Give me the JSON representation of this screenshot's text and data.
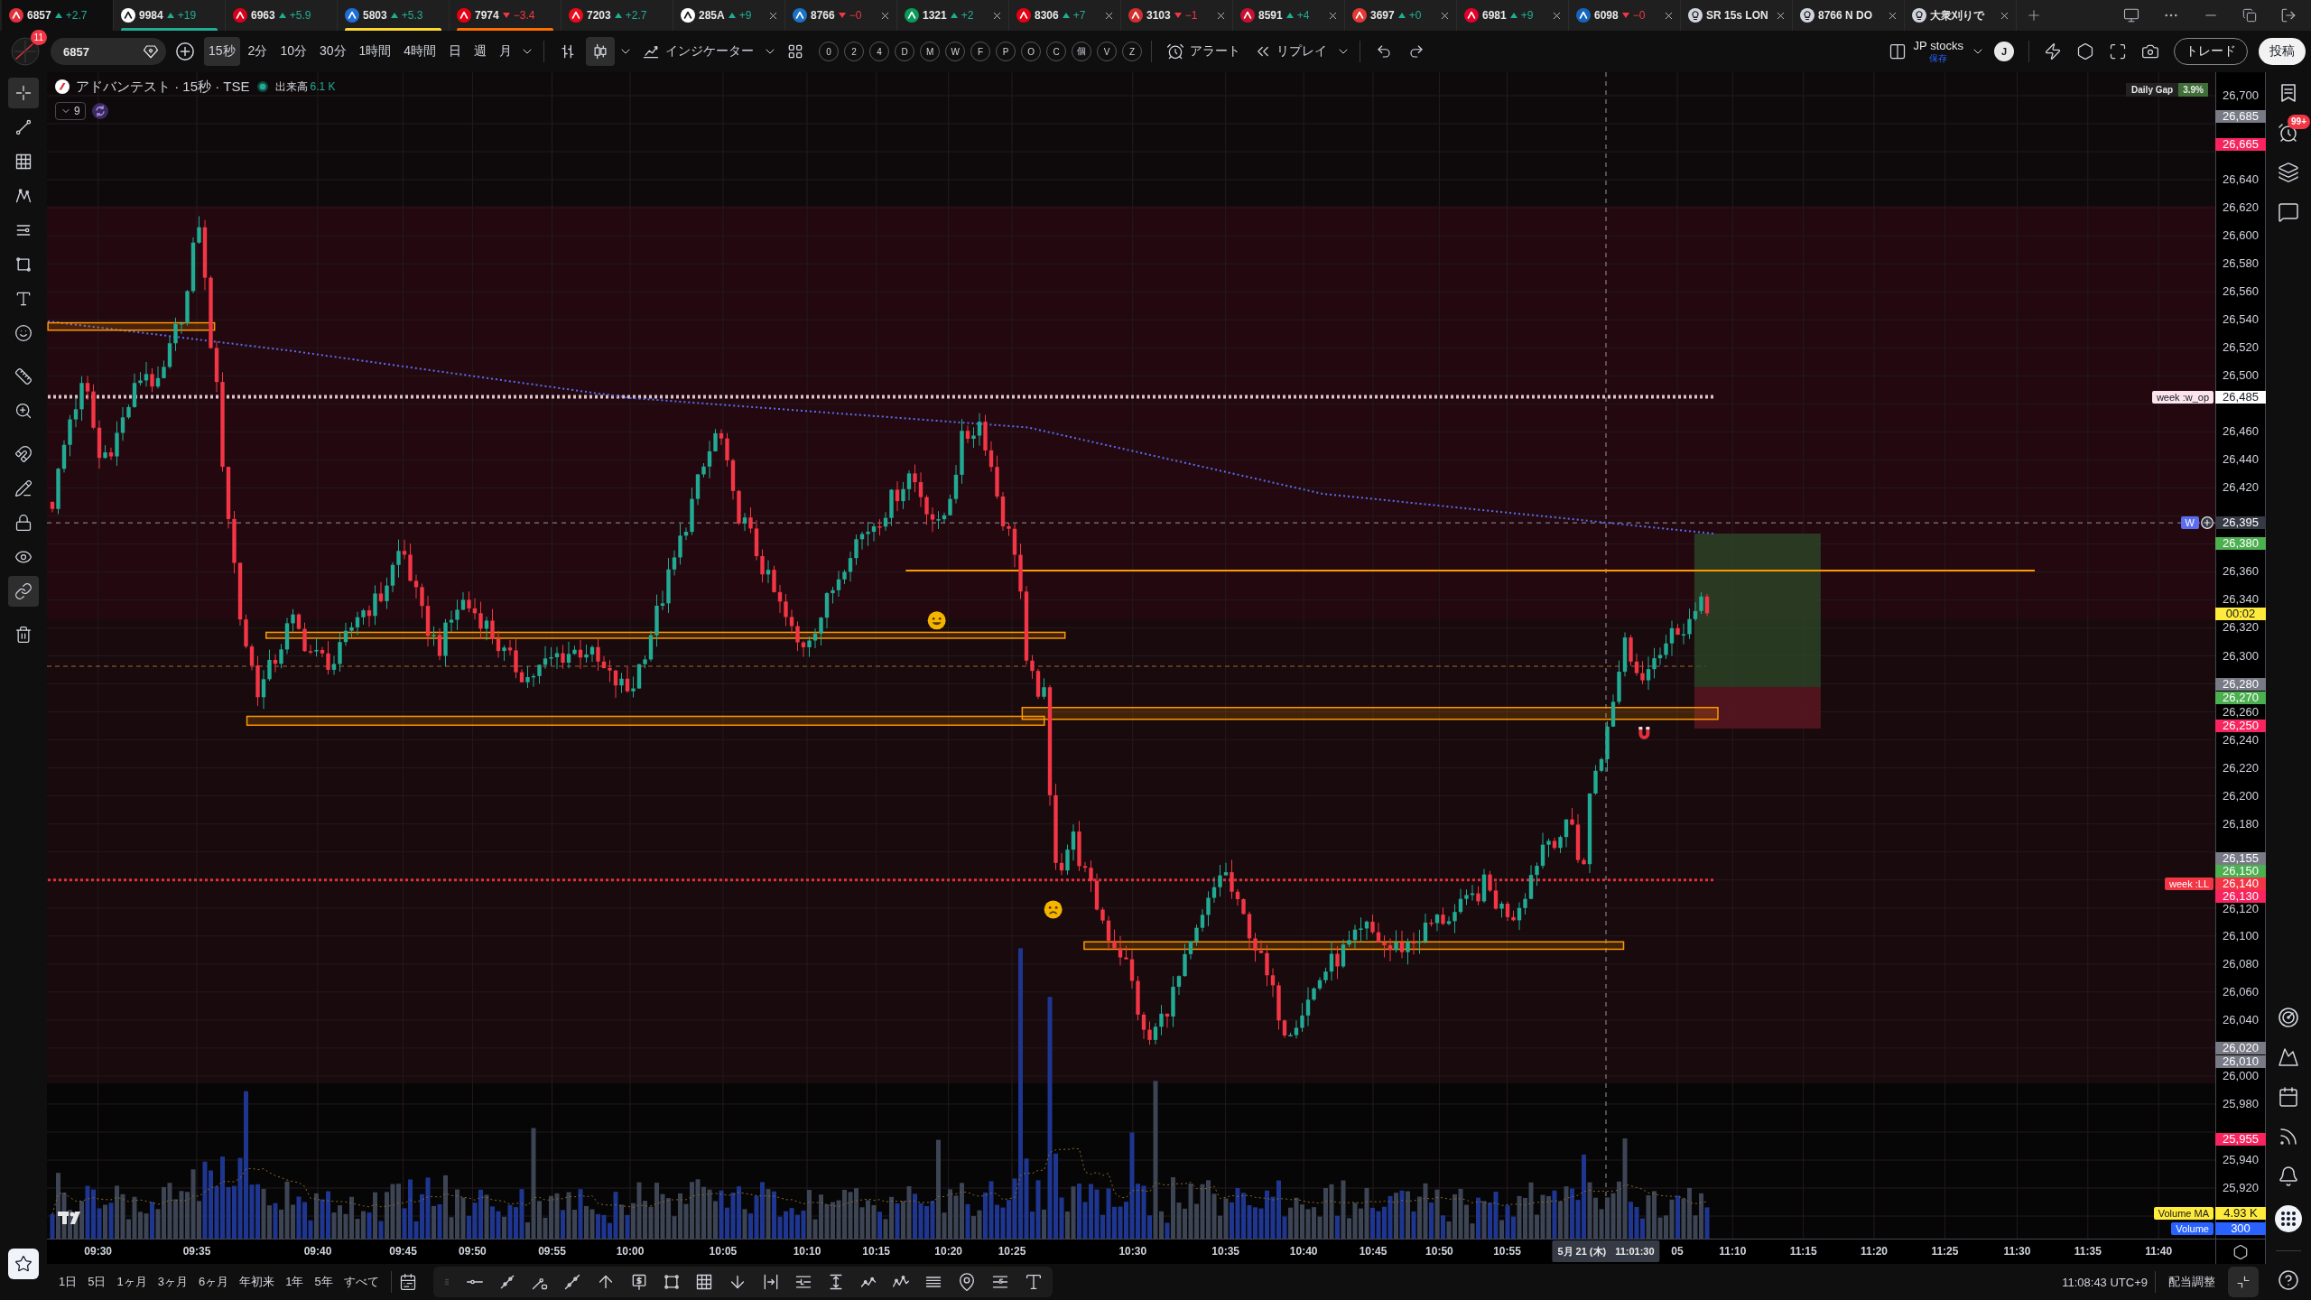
{
  "tabs": [
    {
      "kind": "symbol",
      "symbol": "6857",
      "rising": true,
      "change": "+2.7",
      "selected": true,
      "closable": false,
      "logo": {
        "color": "#e0303c"
      }
    },
    {
      "kind": "symbol",
      "symbol": "9984",
      "rising": true,
      "change": "+19",
      "selected": false,
      "closable": false,
      "logo": {
        "color": "#ffffff"
      },
      "color": "#22ab94"
    },
    {
      "kind": "symbol",
      "symbol": "6963",
      "rising": true,
      "change": "+5.9",
      "selected": false,
      "closable": false,
      "logo": {
        "color": "#d9001b"
      }
    },
    {
      "kind": "symbol",
      "symbol": "5803",
      "rising": true,
      "change": "+5.3",
      "selected": false,
      "closable": false,
      "logo": {
        "color": "#1e6fd9"
      },
      "color": "#fdd835"
    },
    {
      "kind": "symbol",
      "symbol": "7974",
      "rising": false,
      "change": "−3.4",
      "selected": false,
      "closable": false,
      "logo": {
        "color": "#e60012"
      },
      "color": "#ff6d00"
    },
    {
      "kind": "symbol",
      "symbol": "7203",
      "rising": true,
      "change": "+2.7",
      "selected": false,
      "closable": false,
      "logo": {
        "color": "#eb0a1e"
      }
    },
    {
      "kind": "symbol",
      "symbol": "285A",
      "rising": true,
      "change": "+9",
      "selected": false,
      "closable": true,
      "logo": {
        "color": "#ffffff"
      }
    },
    {
      "kind": "symbol",
      "symbol": "8766",
      "rising": false,
      "change": "−0",
      "selected": false,
      "closable": true,
      "logo": {
        "color": "#1a73c8"
      }
    },
    {
      "kind": "symbol",
      "symbol": "1321",
      "rising": true,
      "change": "+2",
      "selected": false,
      "closable": true,
      "logo": {
        "color": "#0a9a5a"
      }
    },
    {
      "kind": "symbol",
      "symbol": "8306",
      "rising": true,
      "change": "+7",
      "selected": false,
      "closable": true,
      "logo": {
        "color": "#e60012"
      }
    },
    {
      "kind": "symbol",
      "symbol": "3103",
      "rising": false,
      "change": "−1",
      "selected": false,
      "closable": true,
      "logo": {
        "color": "#d32f2f"
      }
    },
    {
      "kind": "symbol",
      "symbol": "8591",
      "rising": true,
      "change": "+4",
      "selected": false,
      "closable": true,
      "logo": {
        "color": "#c8102e"
      }
    },
    {
      "kind": "symbol",
      "symbol": "3697",
      "rising": true,
      "change": "+0",
      "selected": false,
      "closable": true,
      "logo": {
        "color": "#e53935"
      }
    },
    {
      "kind": "symbol",
      "symbol": "6981",
      "rising": true,
      "change": "+9",
      "selected": false,
      "closable": true,
      "logo": {
        "color": "#e4002b"
      }
    },
    {
      "kind": "symbol",
      "symbol": "6098",
      "rising": false,
      "change": "−0",
      "selected": false,
      "closable": true,
      "logo": {
        "color": "#1565c0"
      }
    },
    {
      "kind": "script",
      "title": "SR 15s LON",
      "selected": false,
      "closable": true
    },
    {
      "kind": "script",
      "title": "8766 N DO",
      "selected": false,
      "closable": true
    },
    {
      "kind": "script",
      "title": "大衆刈りで",
      "selected": false,
      "closable": true
    }
  ],
  "toolbar": {
    "avatar_badge": "11",
    "symbol": "6857",
    "intervals": [
      {
        "label": "15秒",
        "selected": true
      },
      {
        "label": "2分",
        "selected": false
      },
      {
        "label": "10分",
        "selected": false
      },
      {
        "label": "30分",
        "selected": false
      },
      {
        "label": "1時間",
        "selected": false
      },
      {
        "label": "4時間",
        "selected": false
      },
      {
        "label": "日",
        "selected": false
      },
      {
        "label": "週",
        "selected": false
      },
      {
        "label": "月",
        "selected": false
      }
    ],
    "chart_types": [
      {
        "kind": "bars",
        "selected": false
      },
      {
        "kind": "candles",
        "selected": true
      }
    ],
    "indicators": "インジケーター",
    "quick_buttons": [
      "0",
      "2",
      "4",
      "D",
      "M",
      "W",
      "F",
      "P",
      "O",
      "C",
      "個",
      "V",
      "Z"
    ],
    "alert": "アラート",
    "replay": "リプレイ",
    "layout_name": "JP stocks",
    "layout_status": "保存",
    "user_initial": "J",
    "trade": "トレード",
    "publish": "投稿"
  },
  "drawing_tools": [
    {
      "kind": "crosshair",
      "selected": true
    },
    {
      "kind": "trend_line",
      "selected": false
    },
    {
      "kind": "fib",
      "selected": false
    },
    {
      "kind": "pattern",
      "selected": false
    },
    {
      "kind": "projection",
      "selected": false
    },
    {
      "kind": "shapes",
      "selected": false
    },
    {
      "kind": "text",
      "selected": false
    },
    {
      "kind": "emoji",
      "selected": false
    },
    {
      "kind": "ruler",
      "selected": false
    },
    {
      "kind": "zoom",
      "selected": false
    },
    {
      "kind": "magnet",
      "selected": false
    },
    {
      "kind": "stay_drawing",
      "selected": false
    },
    {
      "kind": "lock",
      "selected": false
    },
    {
      "kind": "hide",
      "selected": false
    },
    {
      "kind": "sync",
      "selected": true
    },
    {
      "kind": "trash",
      "selected": false
    }
  ],
  "chart": {
    "legend": {
      "title": "アドバンテスト · 15秒 · TSE",
      "volume_label": "出来高",
      "volume_value": "6.1 K",
      "collapse_count": "9"
    },
    "daily_gap": {
      "label": "Daily Gap",
      "value": "3.9%"
    },
    "price_axis": {
      "ticks": [
        "26,700",
        "26,640",
        "26,620",
        "26,600",
        "26,580",
        "26,560",
        "26,540",
        "26,520",
        "26,500",
        "26,460",
        "26,440",
        "26,420",
        "26,360",
        "26,340",
        "26,320",
        "26,300",
        "26,260",
        "26,240",
        "26,220",
        "26,200",
        "26,180",
        "26,120",
        "26,100",
        "26,080",
        "26,060",
        "26,040",
        "26,000",
        "25,980",
        "25,940",
        "25,920"
      ],
      "tags": [
        {
          "text": "26,685",
          "color": "#787b86"
        },
        {
          "text": "26,665",
          "color": "#f7245f"
        },
        {
          "text": "26,485",
          "color": "#ffffff",
          "label": {
            "text": "week :w_op",
            "color": "#fce4ec"
          }
        },
        {
          "kind": "crosshair",
          "text": "26,395",
          "color": "#363a45",
          "label": {
            "text": "W",
            "color": "#5b6cf0"
          }
        },
        {
          "text": "26,380",
          "color": "#4caf50"
        },
        {
          "text": "26,280",
          "color": "#787b86"
        },
        {
          "text": "26,270",
          "color": "#4caf50"
        },
        {
          "text": "26,250",
          "color": "#f7245f"
        },
        {
          "text": "26,155",
          "color": "#787b86"
        },
        {
          "text": "26,150",
          "color": "#4caf50"
        },
        {
          "text": "26,140",
          "color": "#f23645",
          "label": {
            "text": "week :LL",
            "color": "#f23645"
          }
        },
        {
          "text": "26,130",
          "color": "#f7245f"
        },
        {
          "text": "26,020",
          "color": "#787b86"
        },
        {
          "text": "26,010",
          "color": "#787b86"
        },
        {
          "text": "25,955",
          "color": "#f7245f"
        }
      ],
      "countdown": "00:02",
      "indicators": [
        {
          "label": "Volume MA",
          "value": "4.93 K",
          "color": "#ffeb3b"
        },
        {
          "label": "Volume",
          "value": "300",
          "color": "#2962ff"
        }
      ]
    },
    "time_axis": {
      "ticks": [
        "09:30",
        "09:35",
        "09:40",
        "09:45",
        "09:50",
        "09:55",
        "10:00",
        "10:05",
        "10:10",
        "10:15",
        "10:20",
        "10:25",
        "10:30",
        "10:35",
        "10:40",
        "10:45",
        "10:50",
        "10:55",
        "05",
        "11:10",
        "11:15",
        "11:20",
        "11:25",
        "11:30",
        "11:35",
        "11:40"
      ],
      "crosshair_date": "5月 21 (木)",
      "crosshair_time": "11:01:30"
    }
  },
  "bottom_bar": {
    "ranges": [
      "1日",
      "5日",
      "1ヶ月",
      "3ヶ月",
      "6ヶ月",
      "年初来",
      "1年",
      "5年",
      "すべて"
    ],
    "clock": "11:08:43 UTC+9",
    "adjust": "配当調整"
  },
  "sidebar": {
    "alerts_badge": "99+"
  }
}
